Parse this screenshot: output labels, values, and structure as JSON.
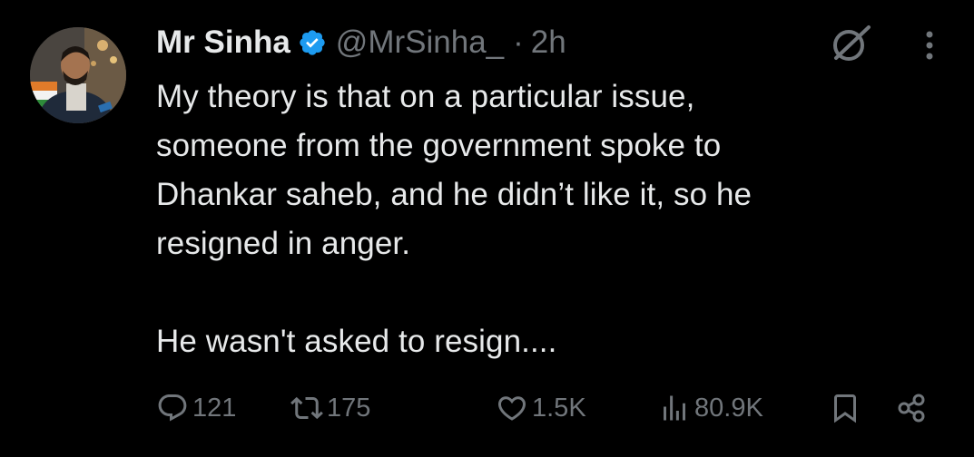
{
  "post": {
    "author": {
      "display_name": "Mr Sinha",
      "handle": "@MrSinha_",
      "verified": true,
      "verified_color": "#1d9bf0"
    },
    "separator": "·",
    "time": "2h",
    "text": "My theory is that on a particular issue,\nsomeone from the government spoke to\nDhankar saheb, and he didn’t like it, so he\nresigned in anger.\n\nHe wasn't asked to resign....",
    "icons": {
      "header_right": [
        "grok-icon",
        "more-icon"
      ],
      "actions": [
        "reply-icon",
        "repost-icon",
        "like-icon",
        "views-icon",
        "bookmark-icon",
        "share-icon"
      ]
    }
  },
  "actions": {
    "replies": "121",
    "reposts": "175",
    "likes": "1.5K",
    "views": "80.9K"
  },
  "colors": {
    "background": "#000000",
    "primary_text": "#e7e9ea",
    "secondary_text": "#71767b"
  }
}
